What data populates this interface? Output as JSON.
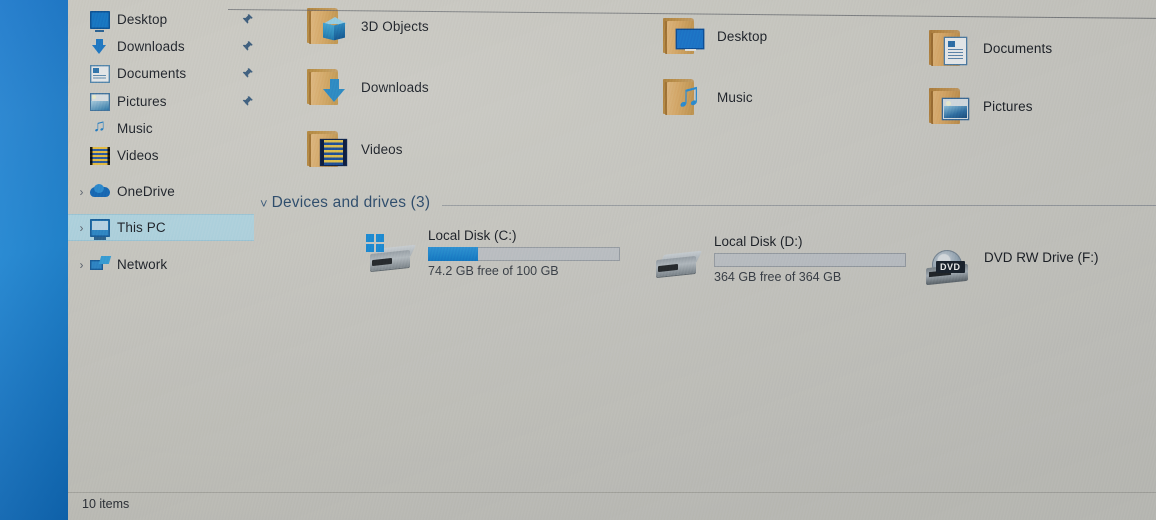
{
  "window": {
    "status_text": "10 items"
  },
  "sidebar": {
    "items": [
      {
        "label": "Desktop",
        "icon": "monitor-icon",
        "chevron": "",
        "pinned": true,
        "selected": false
      },
      {
        "label": "Downloads",
        "icon": "download-icon",
        "chevron": "",
        "pinned": true,
        "selected": false
      },
      {
        "label": "Documents",
        "icon": "document-icon",
        "chevron": "",
        "pinned": true,
        "selected": false
      },
      {
        "label": "Pictures",
        "icon": "picture-icon",
        "chevron": "",
        "pinned": true,
        "selected": false
      },
      {
        "label": "Music",
        "icon": "music-icon",
        "chevron": "",
        "pinned": false,
        "selected": false
      },
      {
        "label": "Videos",
        "icon": "video-icon",
        "chevron": "",
        "pinned": false,
        "selected": false
      },
      {
        "label": "OneDrive",
        "icon": "onedrive-icon",
        "chevron": "›",
        "pinned": false,
        "selected": false
      },
      {
        "label": "This PC",
        "icon": "this-pc-icon",
        "chevron": "›",
        "pinned": false,
        "selected": true
      },
      {
        "label": "Network",
        "icon": "network-icon",
        "chevron": "›",
        "pinned": false,
        "selected": false
      }
    ],
    "pin_glyph": "📌"
  },
  "folders": [
    {
      "label": "3D Objects",
      "glyph": "cube-icon"
    },
    {
      "label": "Downloads",
      "glyph": "down-arrow-icon"
    },
    {
      "label": "Videos",
      "glyph": "film-strip-icon"
    },
    {
      "label": "Desktop",
      "glyph": "monitor-icon"
    },
    {
      "label": "Music",
      "glyph": "music-note-icon"
    },
    {
      "label": "Documents",
      "glyph": "document-page-icon"
    },
    {
      "label": "Pictures",
      "glyph": "photo-icon"
    }
  ],
  "devices_group": {
    "title": "Devices and drives (3)",
    "chevron": "˅"
  },
  "drives": [
    {
      "name": "Local Disk (C:)",
      "free_text": "74.2 GB free of 100 GB",
      "used_percent": 26,
      "icon": "hard-drive-windows-icon",
      "has_bar": true,
      "badge": ""
    },
    {
      "name": "Local Disk (D:)",
      "free_text": "364 GB free of 364 GB",
      "used_percent": 0,
      "icon": "hard-drive-icon",
      "has_bar": true,
      "badge": ""
    },
    {
      "name": "DVD RW Drive (F:)",
      "free_text": "",
      "used_percent": 0,
      "icon": "dvd-drive-icon",
      "has_bar": false,
      "badge": "DVD"
    }
  ],
  "colors": {
    "accent_blue": "#1477cd",
    "selection_blue": "#b3dcec",
    "wallpaper_blue": "#1b7fd0",
    "group_header_text": "#2d4a69",
    "folder_manila": "#dda864"
  }
}
